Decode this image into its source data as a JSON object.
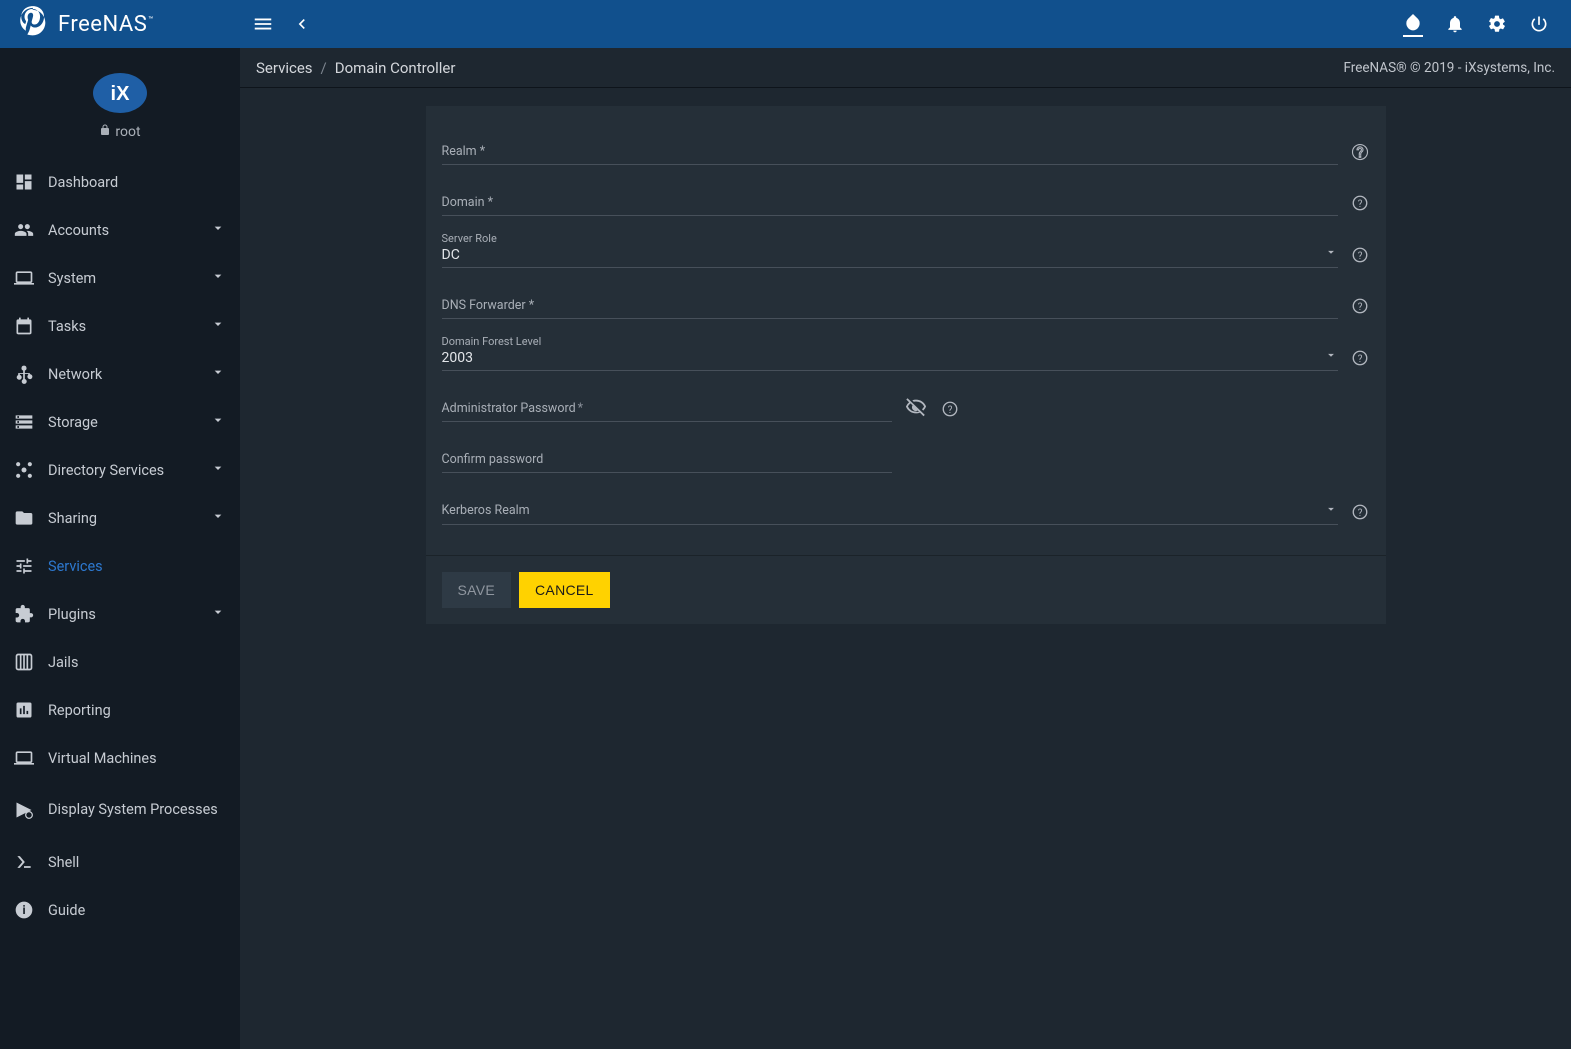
{
  "app": {
    "name": "FreeNAS",
    "copyright": "FreeNAS® © 2019 - iXsystems, Inc."
  },
  "user": {
    "name": "root"
  },
  "breadcrumbs": {
    "parent": "Services",
    "current": "Domain Controller"
  },
  "sidebar": {
    "items": [
      {
        "label": "Dashboard"
      },
      {
        "label": "Accounts"
      },
      {
        "label": "System"
      },
      {
        "label": "Tasks"
      },
      {
        "label": "Network"
      },
      {
        "label": "Storage"
      },
      {
        "label": "Directory Services"
      },
      {
        "label": "Sharing"
      },
      {
        "label": "Services"
      },
      {
        "label": "Plugins"
      },
      {
        "label": "Jails"
      },
      {
        "label": "Reporting"
      },
      {
        "label": "Virtual Machines"
      },
      {
        "label": "Display System Processes"
      },
      {
        "label": "Shell"
      },
      {
        "label": "Guide"
      }
    ]
  },
  "form": {
    "realm": {
      "label": "Realm *",
      "value": ""
    },
    "domain": {
      "label": "Domain *",
      "value": ""
    },
    "server_role": {
      "label": "Server Role",
      "value": "DC"
    },
    "dns_forwarder": {
      "label": "DNS Forwarder *",
      "value": ""
    },
    "forest_level": {
      "label": "Domain Forest Level",
      "value": "2003"
    },
    "admin_pw": {
      "label": "Administrator Password",
      "req": "*",
      "value": ""
    },
    "confirm_pw": {
      "label": "Confirm password",
      "value": ""
    },
    "kerberos": {
      "label": "Kerberos Realm",
      "value": ""
    },
    "save_label": "SAVE",
    "cancel_label": "CANCEL"
  }
}
